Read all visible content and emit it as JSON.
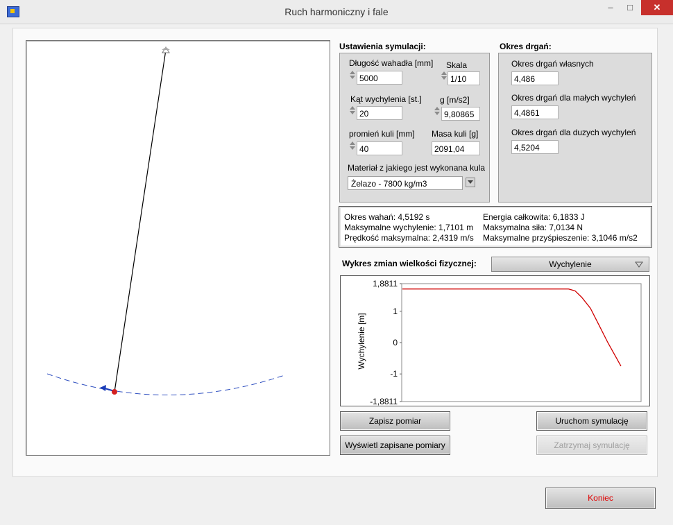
{
  "window": {
    "title": "Ruch harmoniczny i fale"
  },
  "settings": {
    "section_title": "Ustawienia symulacji:",
    "length_label": "Długość wahadła [mm]",
    "length_value": "5000",
    "scale_label": "Skala",
    "scale_value": "1/10",
    "angle_label": "Kąt wychylenia [st.]",
    "angle_value": "20",
    "g_label": "g [m/s2]",
    "g_value": "9,80865",
    "radius_label": "promień kuli [mm]",
    "radius_value": "40",
    "mass_label": "Masa kuli [g]",
    "mass_value": "2091,04",
    "material_label": "Materiał z jakiego jest wykonana kula",
    "material_value": "Żelazo - 7800 kg/m3"
  },
  "period": {
    "section_title": "Okres drgań:",
    "natural_label": "Okres drgań własnych",
    "natural_value": "4,486",
    "small_label": "Okres drgań dla małych wychyleń",
    "small_value": "4,4861",
    "large_label": "Okres drgań dla duzych wychyleń",
    "large_value": "4,5204"
  },
  "results": {
    "period": "Okres wahań: 4,5192 s",
    "max_deflection": "Maksymalne wychylenie: 1,7101 m",
    "max_velocity": "Prędkość maksymalna: 2,4319 m/s",
    "total_energy": "Energia całkowita: 6,1833 J",
    "max_force": "Maksymalna siła: 7,0134 N",
    "max_acceleration": "Maksymalne przyśpieszenie: 3,1046 m/s2"
  },
  "plot_selector": {
    "label": "Wykres zmian wielkości fizycznej:",
    "selected": "Wychylenie"
  },
  "buttons": {
    "save": "Zapisz pomiar",
    "show_saved": "Wyświetl zapisane pomiary",
    "start": "Uruchom symulację",
    "stop": "Zatrzymaj symulację",
    "end": "Koniec"
  },
  "icons": [
    "app-icon",
    "minimize-icon",
    "maximize-icon",
    "close-icon",
    "spinner-icon",
    "dropdown-arrow-icon",
    "pivot-icon",
    "velocity-arrow-icon"
  ],
  "colors": {
    "bob": "#d42020",
    "trajectory": "#3050c0",
    "velocity_arrow": "#1b3db8",
    "plot_line": "#d00000",
    "end_button_text": "#e00000"
  },
  "chart_data": {
    "type": "line",
    "title": "",
    "xlabel": "",
    "ylabel": "Wychylenie [m]",
    "ylim": [
      -1.8811,
      1.8811
    ],
    "ytick_labels": [
      "1,8811",
      "1",
      "0",
      "-1",
      "-1,8811"
    ],
    "yticks": [
      1.8811,
      1,
      0,
      -1,
      -1.8811
    ],
    "grid": false,
    "series": [
      {
        "x": [
          0,
          0.76,
          0.79,
          0.82,
          0.86,
          0.9,
          0.94,
          0.98,
          1.0
        ],
        "y": [
          1.71,
          1.71,
          1.65,
          1.45,
          1.1,
          0.55,
          0.0,
          -0.5,
          -0.75
        ]
      }
    ]
  }
}
